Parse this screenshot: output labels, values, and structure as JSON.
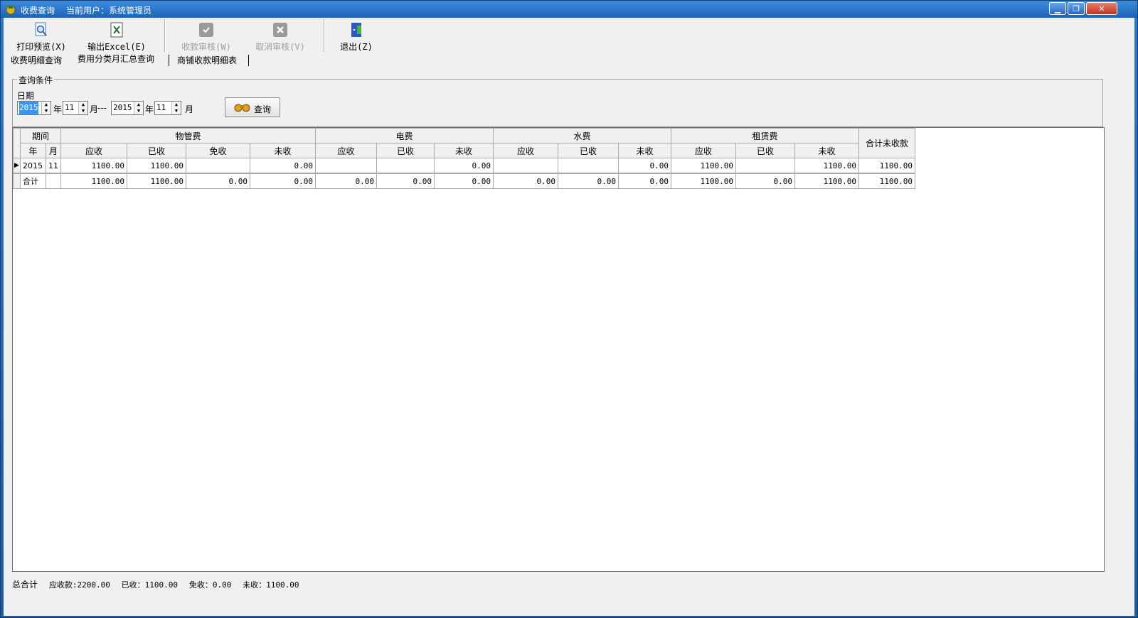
{
  "window": {
    "title": "收费查询",
    "user_text": "当前用户：系统管理员",
    "buttons": {
      "minimize": "▁",
      "restore": "❐",
      "close": "✕"
    }
  },
  "toolbar": {
    "print_preview": "打印预览(X)",
    "export_excel": "输出Excel(E)",
    "audit": "收款审核(W)",
    "cancel_audit": "取消审核(V)",
    "exit": "退出(Z)"
  },
  "tabs": [
    "收费明细查询",
    "费用分类月汇总查询",
    "商铺收款明细表"
  ],
  "query": {
    "group_title": "查询条件",
    "date_label": "日期",
    "from_year": "2015",
    "from_month": "11",
    "to_year": "2015",
    "to_month": "11",
    "unit_year": "年",
    "unit_month": "月",
    "range_sep": "---",
    "query_button": "查询"
  },
  "grid": {
    "groups": {
      "period": "期间",
      "property": "物管费",
      "electricity": "电费",
      "water": "水费",
      "rent": "租赁费",
      "total_unpaid": "合计未收款"
    },
    "sub": {
      "year": "年",
      "month": "月",
      "receivable": "应收",
      "received": "已收",
      "exempt": "免收",
      "unpaid": "未收"
    },
    "rows": [
      {
        "indicator": "▶",
        "year": "2015",
        "month": "11",
        "p_recv": "1100.00",
        "p_got": "1100.00",
        "p_exempt": "",
        "p_unpaid": "0.00",
        "e_recv": "",
        "e_got": "",
        "e_unpaid": "0.00",
        "w_recv": "",
        "w_got": "",
        "w_unpaid": "0.00",
        "r_recv": "1100.00",
        "r_got": "",
        "r_unpaid": "1100.00",
        "total_unpaid": "1100.00"
      }
    ],
    "total_row": {
      "label": "合计",
      "p_recv": "1100.00",
      "p_got": "1100.00",
      "p_exempt": "0.00",
      "p_unpaid": "0.00",
      "e_recv": "0.00",
      "e_got": "0.00",
      "e_unpaid": "0.00",
      "w_recv": "0.00",
      "w_got": "0.00",
      "w_unpaid": "0.00",
      "r_recv": "1100.00",
      "r_got": "0.00",
      "r_unpaid": "1100.00",
      "total_unpaid": "1100.00"
    }
  },
  "status": {
    "label": "总合计",
    "receivable": "应收款:2200.00",
    "received": "已收：1100.00",
    "exempt": "免收：0.00",
    "unpaid": "未收：1100.00"
  },
  "colors": {
    "title_bar": "#1e62b4",
    "selection": "#3399ff"
  }
}
